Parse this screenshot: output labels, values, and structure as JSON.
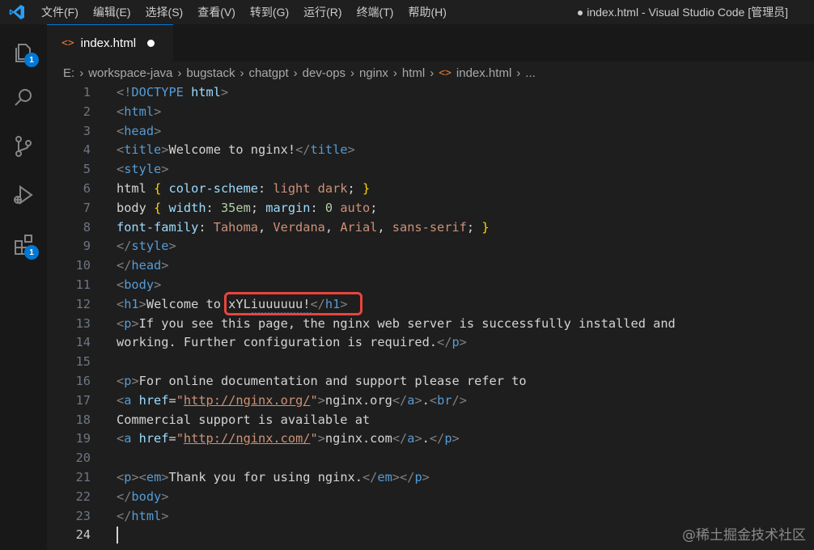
{
  "app": {
    "window_title": "● index.html - Visual Studio Code [管理员]",
    "menu": [
      "文件(F)",
      "编辑(E)",
      "选择(S)",
      "查看(V)",
      "转到(G)",
      "运行(R)",
      "终端(T)",
      "帮助(H)"
    ]
  },
  "activity_bar": {
    "explorer_badge": "1",
    "extensions_badge": "1"
  },
  "tab": {
    "file_icon": "<>",
    "name": "index.html"
  },
  "breadcrumb": {
    "parts": [
      "E:",
      "workspace-java",
      "bugstack",
      "chatgpt",
      "dev-ops",
      "nginx",
      "html"
    ],
    "file_icon": "<>",
    "file": "index.html",
    "tail": "..."
  },
  "editor": {
    "line_numbers": [
      "1",
      "2",
      "3",
      "4",
      "5",
      "6",
      "7",
      "8",
      "9",
      "10",
      "11",
      "12",
      "13",
      "14",
      "15",
      "16",
      "17",
      "18",
      "19",
      "20",
      "21",
      "22",
      "23",
      "24"
    ],
    "lines": [
      [
        [
          "punct",
          "<!"
        ],
        [
          "tag",
          "DOCTYPE "
        ],
        [
          "attr",
          "html"
        ],
        [
          "punct",
          ">"
        ]
      ],
      [
        [
          "punct",
          "<"
        ],
        [
          "tag",
          "html"
        ],
        [
          "punct",
          ">"
        ]
      ],
      [
        [
          "punct",
          "<"
        ],
        [
          "tag",
          "head"
        ],
        [
          "punct",
          ">"
        ]
      ],
      [
        [
          "punct",
          "<"
        ],
        [
          "tag",
          "title"
        ],
        [
          "punct",
          ">"
        ],
        [
          "text",
          "Welcome to nginx!"
        ],
        [
          "punct",
          "</"
        ],
        [
          "tag",
          "title"
        ],
        [
          "punct",
          ">"
        ]
      ],
      [
        [
          "punct",
          "<"
        ],
        [
          "tag",
          "style"
        ],
        [
          "punct",
          ">"
        ]
      ],
      [
        [
          "text",
          "html "
        ],
        [
          "brace",
          "{ "
        ],
        [
          "prop",
          "color-scheme"
        ],
        [
          "text",
          ": "
        ],
        [
          "val",
          "light dark"
        ],
        [
          "text",
          "; "
        ],
        [
          "brace",
          "}"
        ]
      ],
      [
        [
          "text",
          "body "
        ],
        [
          "brace",
          "{ "
        ],
        [
          "prop",
          "width"
        ],
        [
          "text",
          ": "
        ],
        [
          "num",
          "35em"
        ],
        [
          "text",
          "; "
        ],
        [
          "prop",
          "margin"
        ],
        [
          "text",
          ": "
        ],
        [
          "num",
          "0 "
        ],
        [
          "val",
          "auto"
        ],
        [
          "text",
          ";"
        ]
      ],
      [
        [
          "prop",
          "font-family"
        ],
        [
          "text",
          ": "
        ],
        [
          "val",
          "Tahoma"
        ],
        [
          "text",
          ", "
        ],
        [
          "val",
          "Verdana"
        ],
        [
          "text",
          ", "
        ],
        [
          "val",
          "Arial"
        ],
        [
          "text",
          ", "
        ],
        [
          "val",
          "sans-serif"
        ],
        [
          "text",
          "; "
        ],
        [
          "brace",
          "}"
        ]
      ],
      [
        [
          "punct",
          "</"
        ],
        [
          "tag",
          "style"
        ],
        [
          "punct",
          ">"
        ]
      ],
      [
        [
          "punct",
          "</"
        ],
        [
          "tag",
          "head"
        ],
        [
          "punct",
          ">"
        ]
      ],
      [
        [
          "punct",
          "<"
        ],
        [
          "tag",
          "body"
        ],
        [
          "punct",
          ">"
        ]
      ],
      [
        [
          "punct",
          "<"
        ],
        [
          "tag",
          "h1"
        ],
        [
          "punct",
          ">"
        ],
        [
          "text",
          "Welcome to xYLiuuuuuu!"
        ],
        [
          "punct",
          "</"
        ],
        [
          "tag",
          "h1"
        ],
        [
          "punct",
          ">"
        ]
      ],
      [
        [
          "punct",
          "<"
        ],
        [
          "tag",
          "p"
        ],
        [
          "punct",
          ">"
        ],
        [
          "text",
          "If you see this page, the nginx web server is successfully installed and"
        ]
      ],
      [
        [
          "text",
          "working. Further configuration is required."
        ],
        [
          "punct",
          "</"
        ],
        [
          "tag",
          "p"
        ],
        [
          "punct",
          ">"
        ]
      ],
      [],
      [
        [
          "punct",
          "<"
        ],
        [
          "tag",
          "p"
        ],
        [
          "punct",
          ">"
        ],
        [
          "text",
          "For online documentation and support please refer to"
        ]
      ],
      [
        [
          "punct",
          "<"
        ],
        [
          "tag",
          "a "
        ],
        [
          "attr",
          "href"
        ],
        [
          "text",
          "="
        ],
        [
          "str",
          "\""
        ],
        [
          "url",
          "http://nginx.org/"
        ],
        [
          "str",
          "\""
        ],
        [
          "punct",
          ">"
        ],
        [
          "text",
          "nginx.org"
        ],
        [
          "punct",
          "</"
        ],
        [
          "tag",
          "a"
        ],
        [
          "punct",
          ">"
        ],
        [
          "text",
          "."
        ],
        [
          "punct",
          "<"
        ],
        [
          "tag",
          "br"
        ],
        [
          "punct",
          "/>"
        ]
      ],
      [
        [
          "text",
          "Commercial support is available at"
        ]
      ],
      [
        [
          "punct",
          "<"
        ],
        [
          "tag",
          "a "
        ],
        [
          "attr",
          "href"
        ],
        [
          "text",
          "="
        ],
        [
          "str",
          "\""
        ],
        [
          "url",
          "http://nginx.com/"
        ],
        [
          "str",
          "\""
        ],
        [
          "punct",
          ">"
        ],
        [
          "text",
          "nginx.com"
        ],
        [
          "punct",
          "</"
        ],
        [
          "tag",
          "a"
        ],
        [
          "punct",
          ">"
        ],
        [
          "text",
          "."
        ],
        [
          "punct",
          "</"
        ],
        [
          "tag",
          "p"
        ],
        [
          "punct",
          ">"
        ]
      ],
      [],
      [
        [
          "punct",
          "<"
        ],
        [
          "tag",
          "p"
        ],
        [
          "punct",
          "><"
        ],
        [
          "tag",
          "em"
        ],
        [
          "punct",
          ">"
        ],
        [
          "text",
          "Thank you for using nginx."
        ],
        [
          "punct",
          "</"
        ],
        [
          "tag",
          "em"
        ],
        [
          "punct",
          "></"
        ],
        [
          "tag",
          "p"
        ],
        [
          "punct",
          ">"
        ]
      ],
      [
        [
          "punct",
          "</"
        ],
        [
          "tag",
          "body"
        ],
        [
          "punct",
          ">"
        ]
      ],
      [
        [
          "punct",
          "</"
        ],
        [
          "tag",
          "html"
        ],
        [
          "punct",
          ">"
        ]
      ],
      []
    ]
  },
  "watermark": "@稀土掘金技术社区",
  "colors": {
    "accent": "#0078d4",
    "highlight_box": "#e8453c",
    "tag": "#569cd6",
    "string": "#ce9178"
  }
}
